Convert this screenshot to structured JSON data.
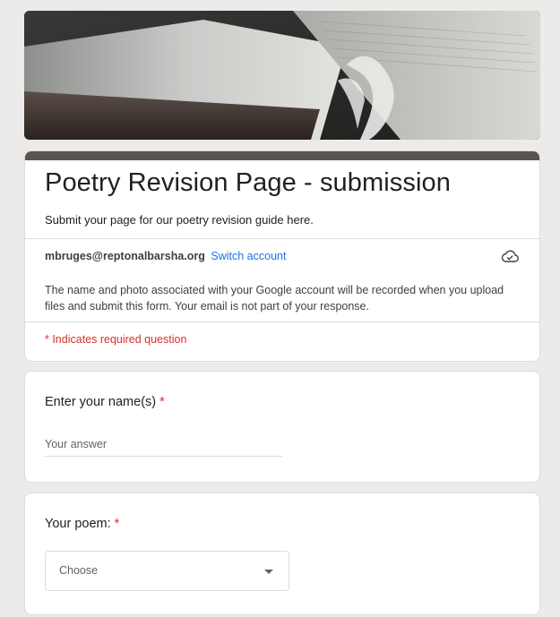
{
  "form": {
    "title": "Poetry Revision Page - submission",
    "description": "Submit your page for our poetry revision guide here.",
    "account_email": "mbruges@reptonalbarsha.org",
    "switch_account": "Switch account",
    "cloud_icon": "cloud-check-icon",
    "notice": "The name and photo associated with your Google account will be recorded when you upload files and submit this form. Your email is not part of your response.",
    "required_note": "* Indicates required question"
  },
  "questions": [
    {
      "label": "Enter your name(s)",
      "required_mark": "*",
      "placeholder": "Your answer"
    },
    {
      "label": "Your poem:",
      "required_mark": "*",
      "selected": "Choose"
    }
  ],
  "colors": {
    "theme_bar": "#595450",
    "link": "#1a73e8",
    "required": "#d93025",
    "background": "#ecebe9"
  }
}
